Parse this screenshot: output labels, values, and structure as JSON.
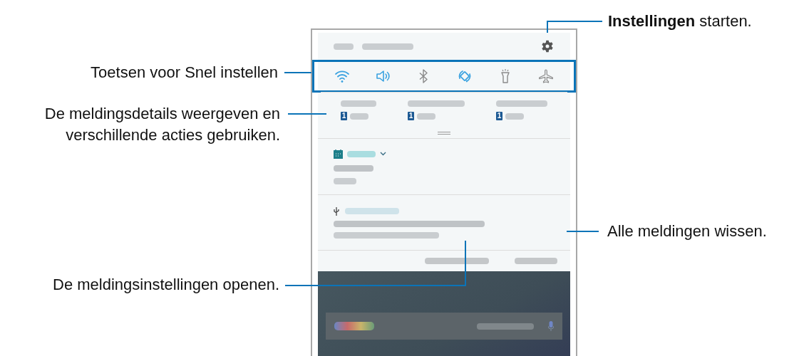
{
  "callouts": [
    {
      "kind": "right",
      "text": "**Instellingen** starten."
    },
    {
      "kind": "left",
      "text": "Toetsen voor Snel instellen"
    },
    {
      "kind": "left",
      "text": "De meldingsdetails weergeven en verschillende acties gebruiken."
    },
    {
      "kind": "right",
      "text": "Alle meldingen wissen."
    },
    {
      "kind": "left",
      "text": "De meldingsinstellingen openen."
    }
  ],
  "quick_tiles": [
    {
      "kind": "wifi",
      "on": true
    },
    {
      "kind": "sound",
      "on": true
    },
    {
      "kind": "bluetooth",
      "on": false
    },
    {
      "kind": "rotate",
      "on": true
    },
    {
      "kind": "flashlight",
      "on": false
    },
    {
      "kind": "airplane",
      "on": false
    }
  ],
  "sim_items": [
    {
      "badge": "1"
    },
    {
      "badge": "1"
    },
    {
      "badge": "1"
    }
  ]
}
